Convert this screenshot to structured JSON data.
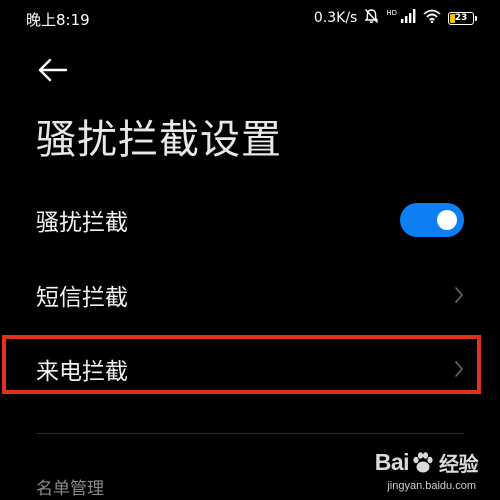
{
  "status_bar": {
    "time": "晚上8:19",
    "network_speed": "0.3K/s",
    "signal_tag": "HD",
    "battery_level": "23",
    "battery_fill_color": "#f5c400",
    "icons": [
      "mute-bell-icon",
      "signal-icon",
      "wifi-icon",
      "battery-icon"
    ]
  },
  "header": {
    "back_icon": "back-arrow-icon",
    "title": "骚扰拦截设置"
  },
  "settings": {
    "items": [
      {
        "label": "骚扰拦截",
        "control": "toggle",
        "enabled": true
      },
      {
        "label": "短信拦截",
        "control": "chevron"
      },
      {
        "label": "来电拦截",
        "control": "chevron",
        "highlighted": true
      }
    ]
  },
  "sections": {
    "list_management": "名单管理"
  },
  "colors": {
    "accent": "#0d7ff2",
    "highlight": "#e0311c",
    "background": "#000000"
  },
  "watermark": {
    "logo_prefix": "Bai",
    "logo_suffix": "经验",
    "url": "jingyan.baidu.com"
  }
}
